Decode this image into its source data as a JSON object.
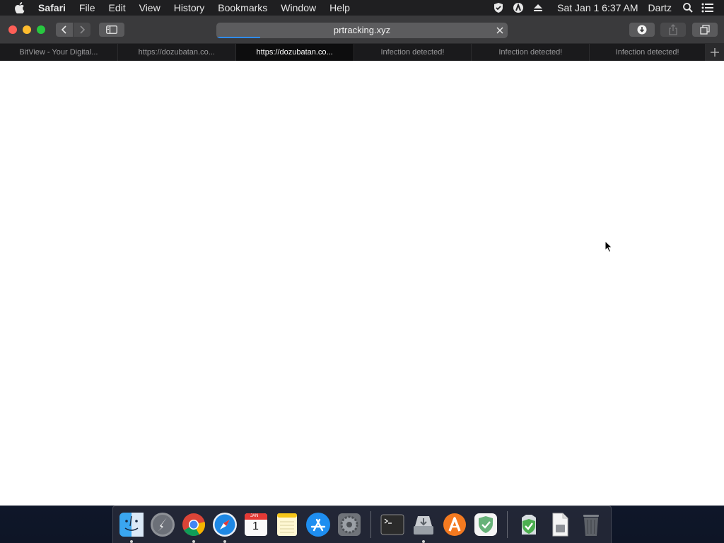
{
  "menubar": {
    "app_name": "Safari",
    "items": [
      "File",
      "Edit",
      "View",
      "History",
      "Bookmarks",
      "Window",
      "Help"
    ],
    "clock": "Sat Jan 1  6:37 AM",
    "user": "Dartz"
  },
  "address_bar": {
    "url": "prtracking.xyz",
    "progress": 0.15
  },
  "tabs": [
    {
      "label": "BitView - Your Digital...",
      "active": false
    },
    {
      "label": "https://dozubatan.co...",
      "active": false
    },
    {
      "label": "https://dozubatan.co...",
      "active": true
    },
    {
      "label": "Infection detected!",
      "active": false
    },
    {
      "label": "Infection detected!",
      "active": false
    },
    {
      "label": "Infection detected!",
      "active": false
    }
  ],
  "colors": {
    "progress": "#2f8cf0",
    "close": "#fe5f57",
    "minimize": "#febc2e",
    "maximize": "#28c840"
  },
  "dock": {
    "apps": [
      {
        "name": "finder-icon",
        "running": true
      },
      {
        "name": "launchpad-icon",
        "running": false
      },
      {
        "name": "chrome-icon",
        "running": true
      },
      {
        "name": "safari-icon",
        "running": true
      },
      {
        "name": "calendar-icon",
        "running": false,
        "label_month": "JAN",
        "label_day": "1"
      },
      {
        "name": "notes-icon",
        "running": false
      },
      {
        "name": "app-store-icon",
        "running": false
      },
      {
        "name": "system-preferences-icon",
        "running": false
      },
      {
        "name": "terminal-icon",
        "running": false
      },
      {
        "name": "disk-utility-icon",
        "running": true
      },
      {
        "name": "avast-icon",
        "running": false
      },
      {
        "name": "adguard-icon",
        "running": false
      },
      {
        "name": "security-installer-icon",
        "running": false
      },
      {
        "name": "document-icon",
        "running": false
      },
      {
        "name": "trash-icon",
        "running": false
      }
    ]
  }
}
